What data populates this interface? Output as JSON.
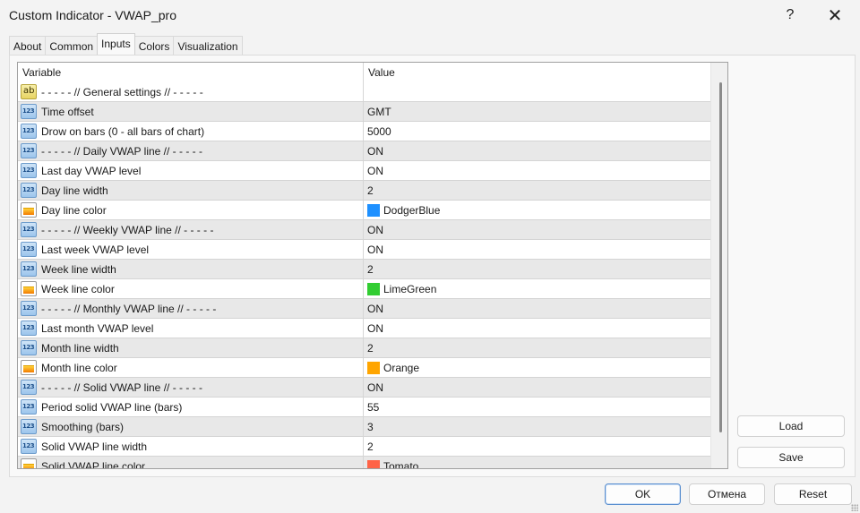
{
  "window": {
    "title": "Custom Indicator - VWAP_pro",
    "help_label": "?",
    "close_label": "✕"
  },
  "tabs": [
    {
      "label": "About",
      "active": false
    },
    {
      "label": "Common",
      "active": false
    },
    {
      "label": "Inputs",
      "active": true
    },
    {
      "label": "Colors",
      "active": false
    },
    {
      "label": "Visualization",
      "active": false
    }
  ],
  "grid": {
    "headers": {
      "variable": "Variable",
      "value": "Value"
    },
    "rows": [
      {
        "icon": "string-icon",
        "icon_text": "ab",
        "variable": "- - - - - // General settings // - - - - -",
        "value": "",
        "swatch": null
      },
      {
        "icon": "number-icon",
        "icon_text": "123",
        "variable": "Time offset",
        "value": "GMT",
        "swatch": null
      },
      {
        "icon": "number-icon",
        "icon_text": "123",
        "variable": "Drow on bars (0 - all bars of chart)",
        "value": "5000",
        "swatch": null
      },
      {
        "icon": "number-icon",
        "icon_text": "123",
        "variable": "- - - - - // Daily VWAP line // - - - - -",
        "value": "ON",
        "swatch": null
      },
      {
        "icon": "number-icon",
        "icon_text": "123",
        "variable": "Last day VWAP level",
        "value": "ON",
        "swatch": null
      },
      {
        "icon": "number-icon",
        "icon_text": "123",
        "variable": "Day line width",
        "value": "2",
        "swatch": null
      },
      {
        "icon": "color-icon",
        "icon_text": "",
        "variable": "Day line color",
        "value": "DodgerBlue",
        "swatch": "#1e90ff"
      },
      {
        "icon": "number-icon",
        "icon_text": "123",
        "variable": "- - - - - // Weekly VWAP line // - - - - -",
        "value": "ON",
        "swatch": null
      },
      {
        "icon": "number-icon",
        "icon_text": "123",
        "variable": "Last week VWAP level",
        "value": "ON",
        "swatch": null
      },
      {
        "icon": "number-icon",
        "icon_text": "123",
        "variable": "Week line width",
        "value": "2",
        "swatch": null
      },
      {
        "icon": "color-icon",
        "icon_text": "",
        "variable": "Week line color",
        "value": "LimeGreen",
        "swatch": "#32cd32"
      },
      {
        "icon": "number-icon",
        "icon_text": "123",
        "variable": "- - - - - // Monthly VWAP line // - - - - -",
        "value": "ON",
        "swatch": null
      },
      {
        "icon": "number-icon",
        "icon_text": "123",
        "variable": "Last month VWAP level",
        "value": "ON",
        "swatch": null
      },
      {
        "icon": "number-icon",
        "icon_text": "123",
        "variable": "Month line width",
        "value": "2",
        "swatch": null
      },
      {
        "icon": "color-icon",
        "icon_text": "",
        "variable": "Month line color",
        "value": "Orange",
        "swatch": "#ffa500"
      },
      {
        "icon": "number-icon",
        "icon_text": "123",
        "variable": "- - - - - // Solid VWAP line // - - - - -",
        "value": "ON",
        "swatch": null
      },
      {
        "icon": "number-icon",
        "icon_text": "123",
        "variable": "Period solid VWAP line (bars)",
        "value": "55",
        "swatch": null
      },
      {
        "icon": "number-icon",
        "icon_text": "123",
        "variable": "Smoothing (bars)",
        "value": "3",
        "swatch": null
      },
      {
        "icon": "number-icon",
        "icon_text": "123",
        "variable": "Solid VWAP line width",
        "value": "2",
        "swatch": null
      },
      {
        "icon": "color-icon",
        "icon_text": "",
        "variable": "Solid VWAP line color",
        "value": "Tomato",
        "swatch": "#ff6347"
      }
    ]
  },
  "buttons": {
    "load": "Load",
    "save": "Save",
    "ok": "OK",
    "cancel": "Отмена",
    "reset": "Reset"
  }
}
